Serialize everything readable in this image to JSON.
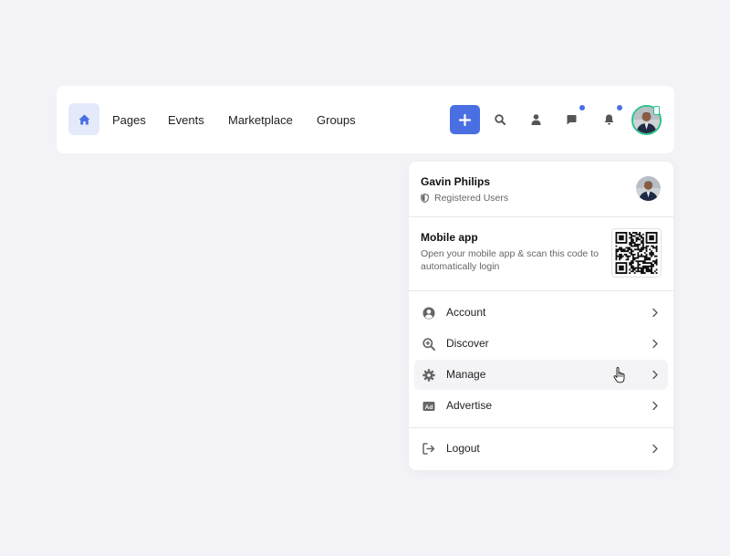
{
  "nav": {
    "home_icon": "home-icon",
    "links": [
      "Pages",
      "Events",
      "Marketplace",
      "Groups"
    ],
    "actions": [
      "plus-icon",
      "search-icon",
      "user-icon",
      "chat-icon",
      "bell-icon"
    ],
    "accent": "#4a6fe3",
    "online_color": "#2bc18b"
  },
  "user": {
    "name": "Gavin Philips",
    "role": "Registered Users"
  },
  "mobile_app": {
    "title": "Mobile app",
    "description": "Open your mobile app & scan this code to automatically login"
  },
  "menu": {
    "items": [
      {
        "label": "Account",
        "icon": "user-circle-icon"
      },
      {
        "label": "Discover",
        "icon": "zoom-plus-icon"
      },
      {
        "label": "Manage",
        "icon": "gear-icon"
      },
      {
        "label": "Advertise",
        "icon": "ad-icon"
      }
    ],
    "logout": {
      "label": "Logout",
      "icon": "logout-icon"
    }
  }
}
